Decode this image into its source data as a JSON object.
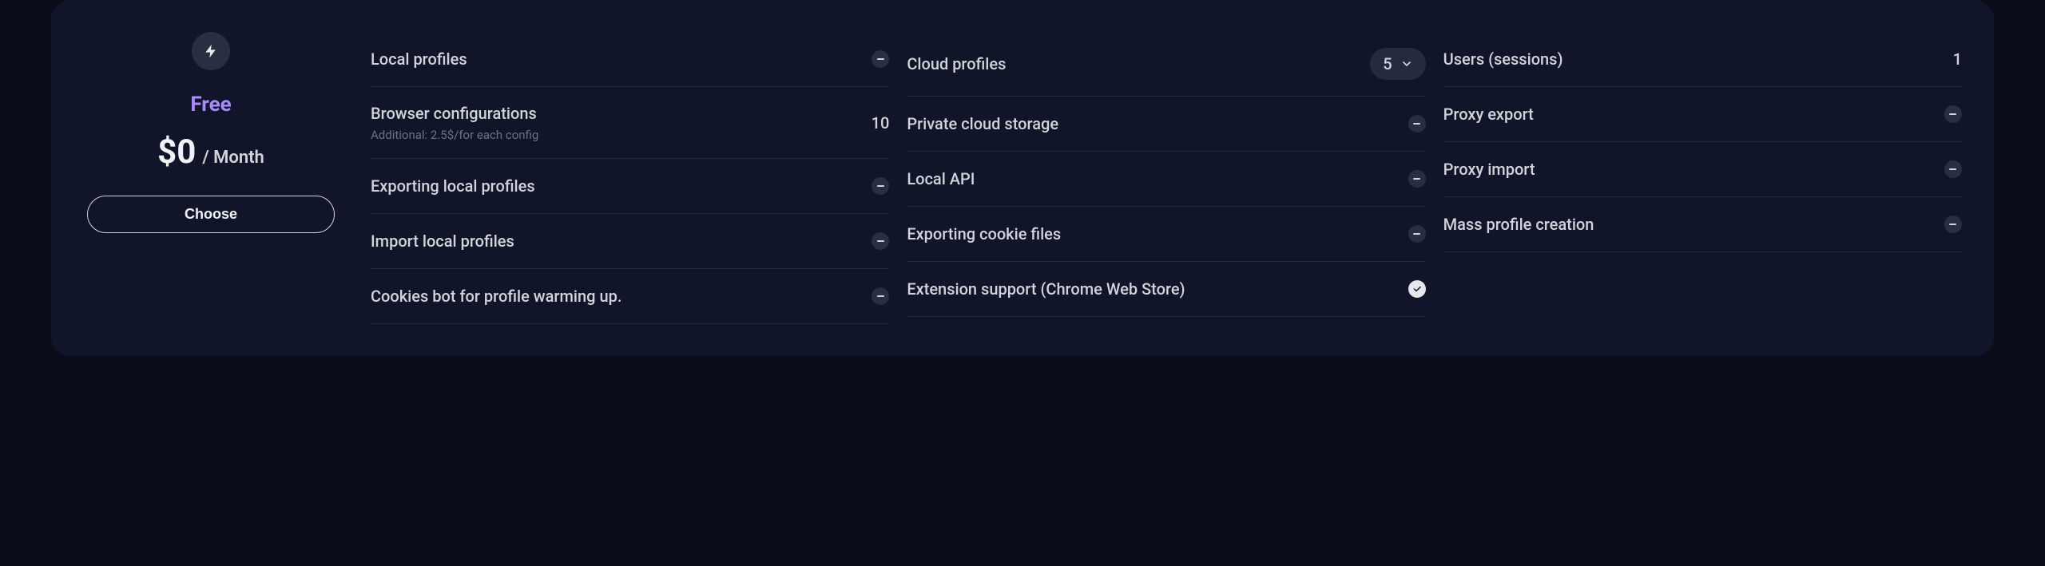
{
  "plan": {
    "name": "Free",
    "price": "$0",
    "period": "/ Month",
    "choose_label": "Choose",
    "icon": "lightning-icon"
  },
  "features": {
    "col1": [
      {
        "label": "Local profiles",
        "value_type": "dash"
      },
      {
        "label": "Browser configurations",
        "sublabel": "Additional: 2.5$/for each config",
        "value_type": "text",
        "value": "10"
      },
      {
        "label": "Exporting local profiles",
        "value_type": "dash"
      },
      {
        "label": "Import local profiles",
        "value_type": "dash"
      },
      {
        "label": "Cookies bot for profile warming up.",
        "value_type": "dash"
      }
    ],
    "col2": [
      {
        "label": "Cloud profiles",
        "value_type": "select",
        "value": "5"
      },
      {
        "label": "Private cloud storage",
        "value_type": "dash"
      },
      {
        "label": "Local API",
        "value_type": "dash"
      },
      {
        "label": "Exporting cookie files",
        "value_type": "dash"
      },
      {
        "label": "Extension support (Chrome Web Store)",
        "value_type": "check"
      }
    ],
    "col3": [
      {
        "label": "Users (sessions)",
        "value_type": "text",
        "value": "1"
      },
      {
        "label": "Proxy export",
        "value_type": "dash"
      },
      {
        "label": "Proxy import",
        "value_type": "dash"
      },
      {
        "label": "Mass profile creation",
        "value_type": "dash"
      }
    ]
  }
}
